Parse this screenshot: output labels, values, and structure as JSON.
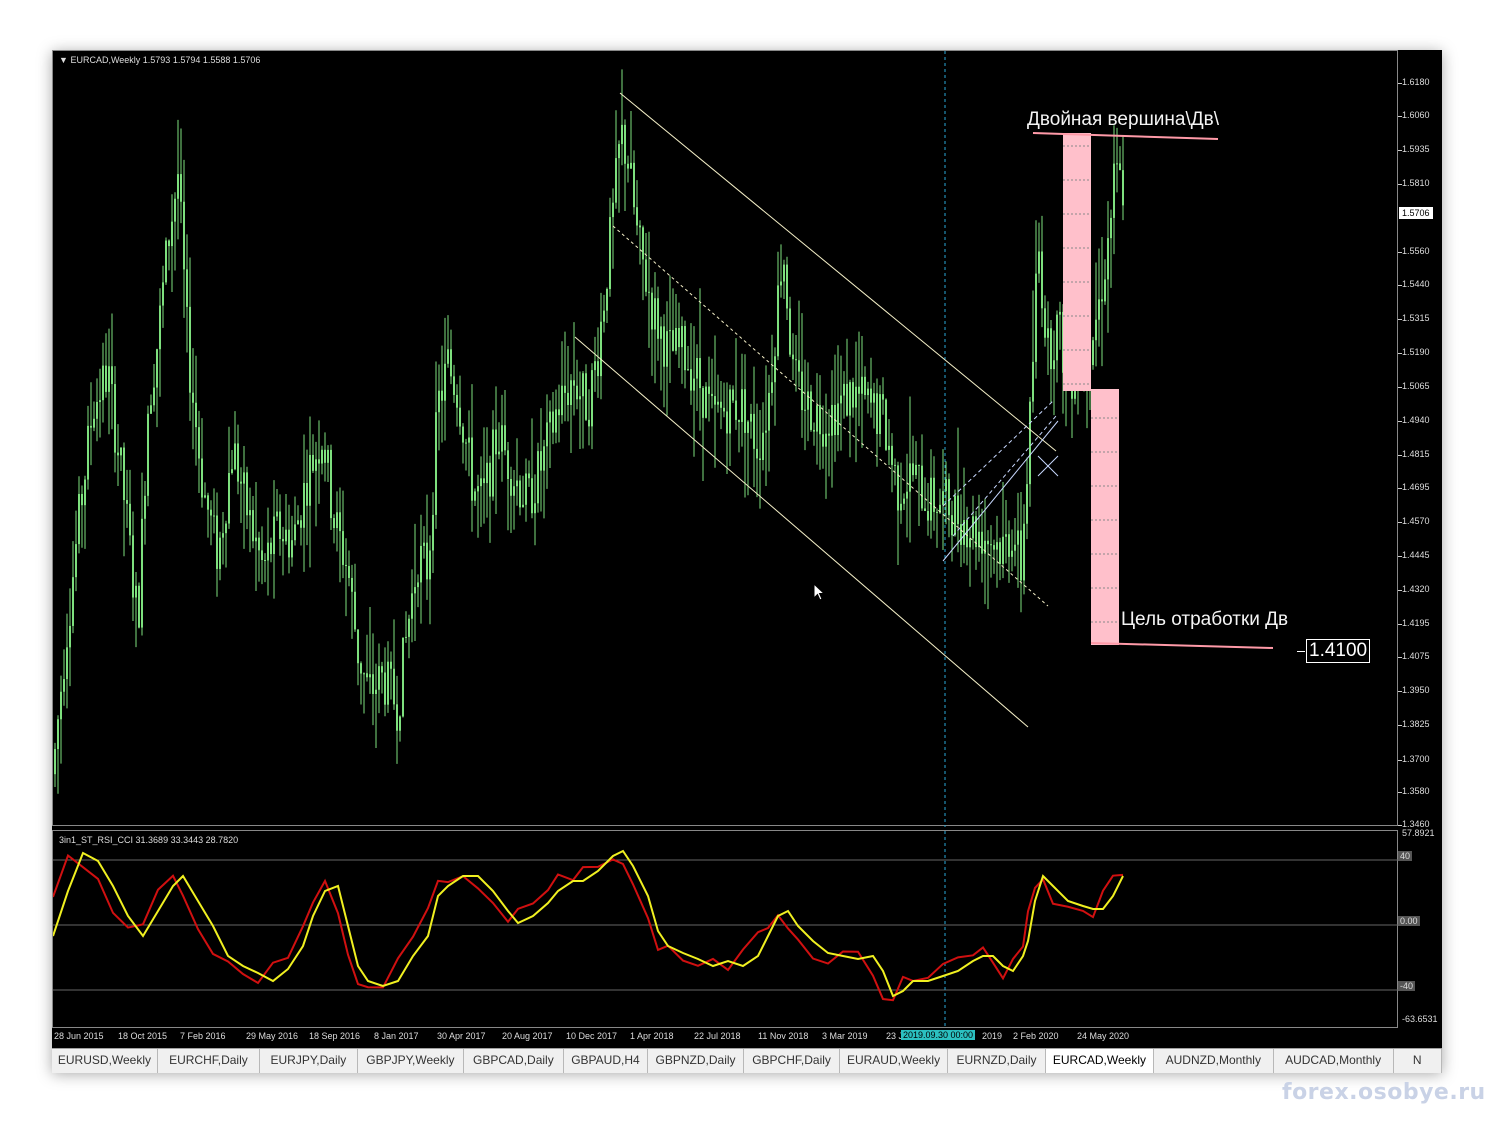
{
  "chart_header": "EURCAD,Weekly  1.5793 1.5794 1.5588 1.5706",
  "indicator_header": "3in1_ST_RSI_CCI 31.3689 33.3443 28.7820",
  "colors": {
    "background": "#000000",
    "candle": "#7ee07e",
    "channel": "#f5f0c8",
    "highlight": "#ffc0cb",
    "indicator_fast": "#d01010",
    "indicator_slow": "#f0f020",
    "crosshair": "#2aa8d8"
  },
  "price_scale": {
    "labels": [
      "1.6180",
      "1.6060",
      "1.5935",
      "1.5810",
      "1.5560",
      "1.5440",
      "1.5315",
      "1.5190",
      "1.5065",
      "1.4940",
      "1.4815",
      "1.4695",
      "1.4570",
      "1.4445",
      "1.4320",
      "1.4195",
      "1.4075",
      "1.3950",
      "1.3825",
      "1.3700",
      "1.3580",
      "1.3460"
    ],
    "current": "1.5706"
  },
  "indicator_scale": {
    "labels": [
      "57.8921",
      "40",
      "0.00",
      "-40",
      "-63.6531"
    ]
  },
  "date_axis": {
    "labels": [
      "28 Jun 2015",
      "18 Oct 2015",
      "7 Feb 2016",
      "29 May 2016",
      "18 Sep 2016",
      "8 Jan 2017",
      "30 Apr 2017",
      "20 Aug 2017",
      "10 Dec 2017",
      "1 Apr 2018",
      "22 Jul 2018",
      "11 Nov 2018",
      "3 Mar 2019",
      "23 J",
      "2019",
      "2 Feb 2020",
      "24 May 2020"
    ],
    "highlight": "2019.09.30 00:00"
  },
  "annotations": {
    "double_top": "Двойная вершина\\Дв\\",
    "target": "Цель отработки Дв",
    "target_value": "1.4100"
  },
  "tabs": [
    {
      "label": "EURUSD,Weekly"
    },
    {
      "label": "EURCHF,Daily"
    },
    {
      "label": "EURJPY,Daily"
    },
    {
      "label": "GBPJPY,Weekly"
    },
    {
      "label": "GBPCAD,Daily"
    },
    {
      "label": "GBPAUD,H4"
    },
    {
      "label": "GBPNZD,Daily"
    },
    {
      "label": "GBPCHF,Daily"
    },
    {
      "label": "EURAUD,Weekly"
    },
    {
      "label": "EURNZD,Daily"
    },
    {
      "label": "EURCAD,Weekly",
      "active": true
    },
    {
      "label": "AUDNZD,Monthly"
    },
    {
      "label": "AUDCAD,Monthly"
    },
    {
      "label": "N"
    }
  ],
  "watermark": "forex.osobye.ru",
  "chart_data": {
    "type": "line",
    "title": "EURCAD,Weekly",
    "ylim": [
      1.346,
      1.618
    ],
    "series": [
      {
        "name": "EURCAD",
        "x": [
          "28 Jun 2015",
          "18 Oct 2015",
          "7 Feb 2016",
          "29 May 2016",
          "18 Sep 2016",
          "8 Jan 2017",
          "30 Apr 2017",
          "20 Aug 2017",
          "10 Dec 2017",
          "1 Apr 2018",
          "22 Jul 2018",
          "11 Nov 2018",
          "3 Mar 2019",
          "2 Feb 2020",
          "24 May 2020"
        ],
        "values": [
          1.42,
          1.5,
          1.52,
          1.46,
          1.45,
          1.39,
          1.5,
          1.47,
          1.53,
          1.56,
          1.52,
          1.53,
          1.5,
          1.47,
          1.58
        ]
      }
    ]
  }
}
